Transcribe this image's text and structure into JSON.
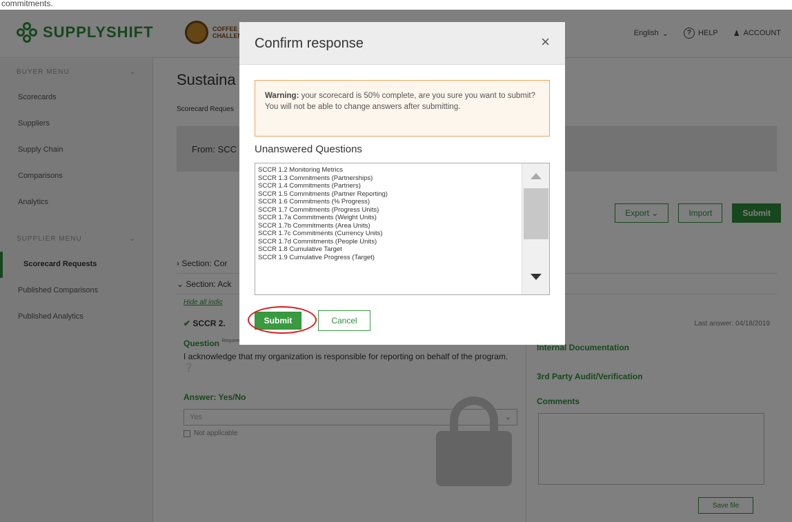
{
  "top_caption": "commitments.",
  "header": {
    "logo_text": "SUPPLYSHIFT",
    "partner_logo_text": "COFFEE",
    "partner_logo_sub": "CHALLENGE",
    "language": "English",
    "help": "HELP",
    "account": "ACCOUNT"
  },
  "sidebar": {
    "buyer_menu": "BUYER MENU",
    "buyer_items": [
      "Scorecards",
      "Suppliers",
      "Supply Chain",
      "Comparisons",
      "Analytics"
    ],
    "supplier_menu": "SUPPLIER MENU",
    "supplier_items": [
      "Scorecard Requests",
      "Published Comparisons",
      "Published Analytics"
    ]
  },
  "main": {
    "title": "Sustaina",
    "breadcrumb": "Scorecard Reques",
    "from_label": "From: SCC",
    "export": "Export",
    "import": "Import",
    "submit": "Submit",
    "section1": "Section: Cor",
    "section2": "Section: Ack",
    "hide_all": "Hide all indic",
    "question_id": "SCCR 2.",
    "last_answer": "Last answer: 04/18/2019",
    "question_label": "Question",
    "question_required": "Required",
    "question_text": "I acknowledge that my organization is responsible for reporting on behalf of the program.",
    "answer_label": "Answer: Yes/No",
    "answer_value": "Yes",
    "not_applicable": "Not applicable",
    "internal_doc": "Internal Documentation",
    "third_party": "3rd Party Audit/Verification",
    "comments": "Comments",
    "save_btn": "Save file"
  },
  "modal": {
    "title": "Confirm response",
    "close": "×",
    "warning_bold": "Warning:",
    "warning_text": " your scorecard is 50% complete, are you sure you want to submit? You will not be able to change answers after submitting.",
    "unanswered_title": "Unanswered Questions",
    "unanswered": [
      "SCCR 1.2 Monitoring Metrics",
      "SCCR 1.3 Commitments (Partnerships)",
      "SCCR 1.4 Commitments (Partners)",
      "SCCR 1.5 Commitments (Partner Reporting)",
      "SCCR 1.6 Commitments (% Progress)",
      "SCCR 1.7 Commitments (Progress Units)",
      "SCCR 1.7a Commitments (Weight Units)",
      "SCCR 1.7b Commitments (Area Units)",
      "SCCR 1.7c Commitments (Currency Units)",
      "SCCR 1.7d Commitments (People Units)",
      "SCCR 1.8 Cumulative Target",
      "SCCR 1.9 Cumulative Progress (Target)"
    ],
    "submit": "Submit",
    "cancel": "Cancel"
  },
  "colors": {
    "accent": "#2f8f3a",
    "warning_border": "#f0a35a",
    "highlight_ring": "#e0191e"
  }
}
